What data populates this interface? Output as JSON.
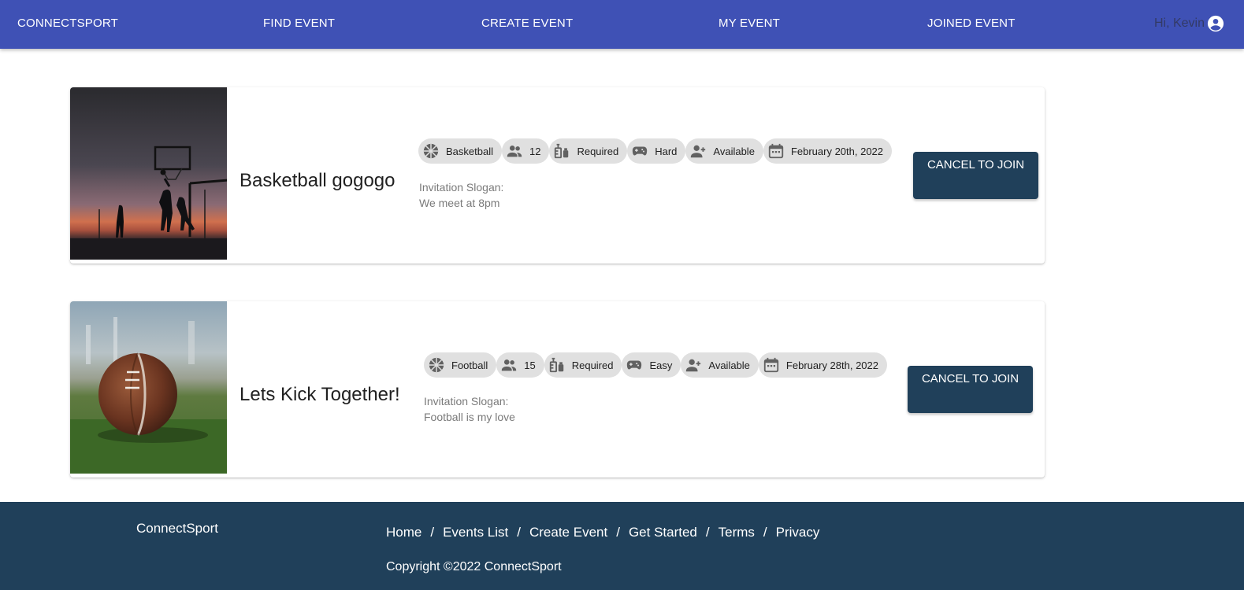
{
  "appbar": {
    "brand": "CONNECTSPORT",
    "nav": [
      "FIND EVENT",
      "CREATE EVENT",
      "MY EVENT",
      "JOINED EVENT"
    ],
    "greeting": "Hi, Kevin",
    "account_icon": "account-circle-icon"
  },
  "events": [
    {
      "title": "Basketball gogogo",
      "sport": "Basketball",
      "participants": "12",
      "vaccine": "Required",
      "difficulty": "Hard",
      "availability": "Available",
      "date": "February 20th, 2022",
      "slogan_label": "Invitation Slogan:",
      "slogan": "We meet at 8pm",
      "button": "CANCEL TO JOIN",
      "image": "basketball-sunset-photo"
    },
    {
      "title": "Lets Kick Together!",
      "sport": "Football",
      "participants": "15",
      "vaccine": "Required",
      "difficulty": "Easy",
      "availability": "Available",
      "date": "February 28th, 2022",
      "slogan_label": "Invitation Slogan:",
      "slogan": "Football is my love",
      "button": "CANCEL TO JOIN",
      "image": "football-on-grass-photo"
    }
  ],
  "footer": {
    "brand": "ConnectSport",
    "links": [
      "Home",
      "Events List",
      "Create Event",
      "Get Started",
      "Terms",
      "Privacy"
    ],
    "separator": "/",
    "copyright": "Copyright ©2022 ConnectSport"
  },
  "colors": {
    "appbar": "#3f51b5",
    "footer": "#20405a",
    "button": "#20405a",
    "chip": "#e0e0e0"
  }
}
